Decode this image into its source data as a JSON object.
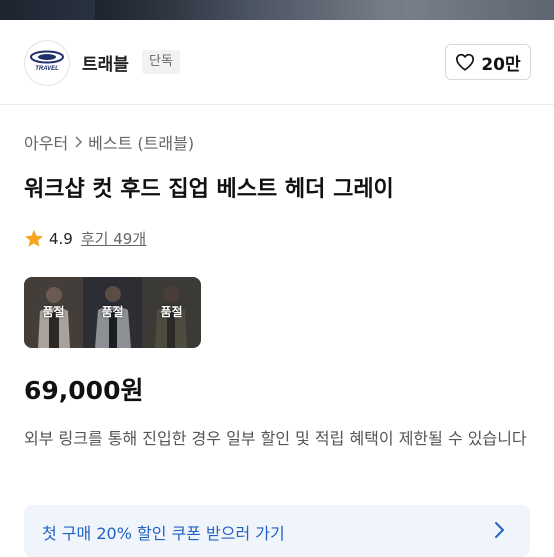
{
  "brand": {
    "logo_text": "TRAVEL",
    "name": "트래블",
    "tag": "단독",
    "like_count": "20만"
  },
  "breadcrumb": {
    "category": "아우터",
    "subcategory": "베스트 (트래블)"
  },
  "product": {
    "title": "워크샵 컷 후드 집업 베스트 헤더 그레이",
    "rating": "4.9",
    "reviews_label": "후기 49개",
    "price": "69,000원",
    "notice": "외부 링크를 통해 진입한 경우 일부 할인 및 적립 혜택이 제한될 수 있습니다"
  },
  "thumbnails": [
    {
      "badge": "품절"
    },
    {
      "badge": "품절"
    },
    {
      "badge": "품절"
    }
  ],
  "coupon": {
    "text": "첫 구매 20% 할인 쿠폰 받으러 가기"
  },
  "colors": {
    "star": "#f5a623",
    "coupon_text": "#2262c6",
    "coupon_bg": "#f0f5fb",
    "logo_blue": "#1f2f6a"
  },
  "icons": {
    "heart": "heart-icon",
    "chevron": "chevron-right-icon",
    "star": "star-icon"
  }
}
